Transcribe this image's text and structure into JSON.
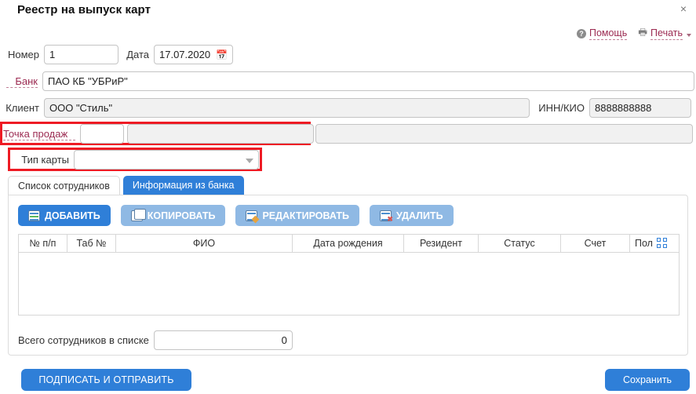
{
  "window": {
    "title": "Реестр на выпуск карт",
    "close_label": "×"
  },
  "toplinks": {
    "help": "Помощь",
    "print": "Печать"
  },
  "form": {
    "number_label": "Номер",
    "number_value": "1",
    "date_label": "Дата",
    "date_value": "17.07.2020",
    "bank_label": "Банк",
    "bank_value": "ПАО КБ \"УБРиР\"",
    "client_label": "Клиент",
    "client_value": "ООО \"Стиль\"",
    "inn_label": "ИНН/КИО",
    "inn_value": "8888888888",
    "pos_label": "Точка продаж",
    "pos_code_value": "",
    "pos_name_value": "",
    "pos_extra_value": "",
    "cardtype_label": "Тип карты",
    "cardtype_value": ""
  },
  "tabs": [
    {
      "label": "Список сотрудников",
      "active": true
    },
    {
      "label": "Информация из банка",
      "active": false
    }
  ],
  "toolbar": [
    {
      "label": "ДОБАВИТЬ",
      "enabled": true
    },
    {
      "label": "КОПИРОВАТЬ",
      "enabled": false
    },
    {
      "label": "РЕДАКТИРОВАТЬ",
      "enabled": false
    },
    {
      "label": "УДАЛИТЬ",
      "enabled": false
    }
  ],
  "grid": {
    "columns": [
      "№ п/п",
      "Таб №",
      "ФИО",
      "Дата рождения",
      "Резидент",
      "Статус",
      "Счет",
      "Пол"
    ],
    "rows": []
  },
  "total": {
    "label": "Всего сотрудников в списке",
    "value": "0"
  },
  "footer": {
    "sign_label": "ПОДПИСАТЬ И ОТПРАВИТЬ",
    "save_label": "Сохранить"
  },
  "colors": {
    "accent_blue": "#2f7fd8",
    "disabled_blue": "#8fb9e4",
    "link_maroon": "#9c2b52",
    "validation_red": "#ee1b24",
    "readonly_gray": "#f1f1f1"
  }
}
